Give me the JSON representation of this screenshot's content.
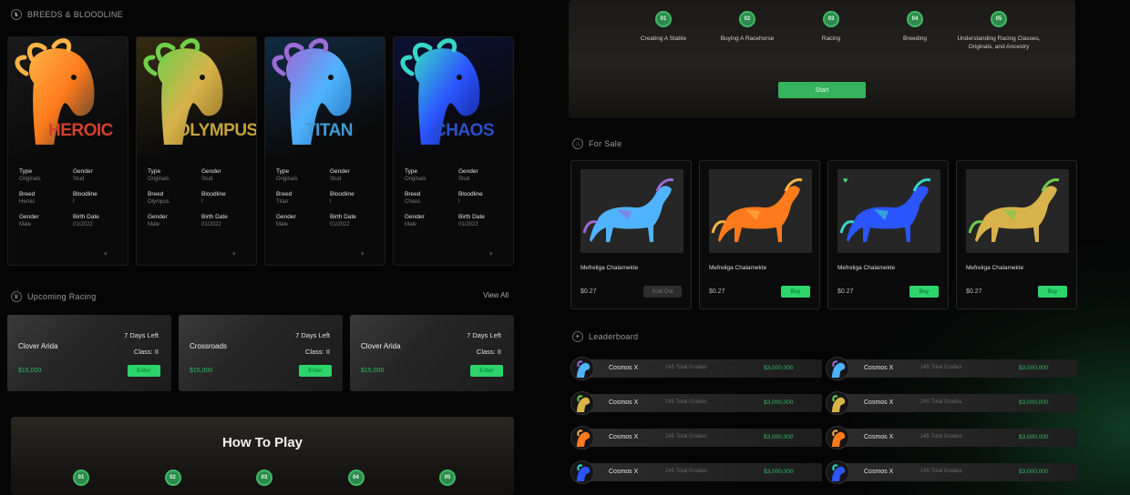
{
  "breeds_section": {
    "title": "BREEDS & BLOODLINE"
  },
  "breeds": [
    {
      "name": "HEROIC",
      "color": "#d2422b",
      "stats": [
        {
          "k": "Type",
          "v": "Originals"
        },
        {
          "k": "Gender",
          "v": "Stud"
        },
        {
          "k": "Breed",
          "v": "Heroic"
        },
        {
          "k": "Bloodline",
          "v": "I"
        },
        {
          "k": "Gender",
          "v": "Male"
        },
        {
          "k": "Birth Date",
          "v": "01/2022"
        }
      ]
    },
    {
      "name": "OLYMPUS",
      "color": "#c5a33c",
      "stats": [
        {
          "k": "Type",
          "v": "Originals"
        },
        {
          "k": "Gender",
          "v": "Stud"
        },
        {
          "k": "Breed",
          "v": "Olympus"
        },
        {
          "k": "Bloodline",
          "v": "I"
        },
        {
          "k": "Gender",
          "v": "Male"
        },
        {
          "k": "Birth Date",
          "v": "01/2022"
        }
      ]
    },
    {
      "name": "TITAN",
      "color": "#3f9bd3",
      "stats": [
        {
          "k": "Type",
          "v": "Originals"
        },
        {
          "k": "Gender",
          "v": "Stud"
        },
        {
          "k": "Breed",
          "v": "Titan"
        },
        {
          "k": "Bloodline",
          "v": "I"
        },
        {
          "k": "Gender",
          "v": "Male"
        },
        {
          "k": "Birth Date",
          "v": "01/2022"
        }
      ]
    },
    {
      "name": "CHAOS",
      "color": "#2c4fc9",
      "stats": [
        {
          "k": "Type",
          "v": "Originals"
        },
        {
          "k": "Gender",
          "v": "Stud"
        },
        {
          "k": "Breed",
          "v": "Chaos"
        },
        {
          "k": "Bloodline",
          "v": "I"
        },
        {
          "k": "Gender",
          "v": "Male"
        },
        {
          "k": "Birth Date",
          "v": "01/2022"
        }
      ]
    }
  ],
  "upcoming": {
    "title": "Upcoming Racing",
    "view_all": "View All"
  },
  "races": [
    {
      "title": "Clover Arida",
      "time_left": "7 Days Left",
      "class": "Class: II",
      "fee": "$15,000",
      "button": "Enter"
    },
    {
      "title": "Crossroads",
      "time_left": "7 Days Left",
      "class": "Class: II",
      "fee": "$15,000",
      "button": "Enter"
    },
    {
      "title": "Clover Arida",
      "time_left": "7 Days Left",
      "class": "Class: II",
      "fee": "$15,000",
      "button": "Enter"
    }
  ],
  "how_to_play": {
    "title": "How To Play",
    "steps": [
      "01",
      "02",
      "03",
      "04",
      "05"
    ]
  },
  "how_steps_top": [
    {
      "num": "01",
      "label": "Creating A Stable"
    },
    {
      "num": "02",
      "label": "Buying A Racehorse"
    },
    {
      "num": "03",
      "label": "Racing"
    },
    {
      "num": "04",
      "label": "Breeding"
    },
    {
      "num": "05",
      "label": "Understanding Racing Classes, Originals, and Ancestry"
    }
  ],
  "start_button": "Start",
  "for_sale": {
    "title": "For Sale"
  },
  "sale_items": [
    {
      "name": "Mefreliga Chalamekte",
      "price": "$0.27",
      "button": "Sold Out",
      "dim": true,
      "fav": false,
      "tone": "titan"
    },
    {
      "name": "Mefreliga Chalamekte",
      "price": "$0.27",
      "button": "Buy",
      "dim": false,
      "fav": false,
      "tone": "heroic"
    },
    {
      "name": "Mefreliga Chalamekte",
      "price": "$0.27",
      "button": "Buy",
      "dim": false,
      "fav": true,
      "tone": "chaos"
    },
    {
      "name": "Mefreliga Chalamekte",
      "price": "$0.27",
      "button": "Buy",
      "dim": false,
      "fav": false,
      "tone": "olympus"
    }
  ],
  "leaderboard": {
    "title": "Leaderboard"
  },
  "leaders": [
    {
      "name": "Cosmos X",
      "sub": "245 Total Grades",
      "amount": "$3,000,000",
      "tone": "titan"
    },
    {
      "name": "Cosmos X",
      "sub": "245 Total Grades",
      "amount": "$3,000,000",
      "tone": "titan"
    },
    {
      "name": "Cosmos X",
      "sub": "245 Total Grades",
      "amount": "$3,000,000",
      "tone": "olympus"
    },
    {
      "name": "Cosmos X",
      "sub": "245 Total Grades",
      "amount": "$3,000,000",
      "tone": "olympus"
    },
    {
      "name": "Cosmos X",
      "sub": "245 Total Grades",
      "amount": "$3,000,000",
      "tone": "heroic"
    },
    {
      "name": "Cosmos X",
      "sub": "245 Total Grades",
      "amount": "$3,000,000",
      "tone": "heroic"
    },
    {
      "name": "Cosmos X",
      "sub": "245 Total Grades",
      "amount": "$3,000,000",
      "tone": "chaos"
    },
    {
      "name": "Cosmos X",
      "sub": "245 Total Grades",
      "amount": "$3,000,000",
      "tone": "chaos"
    }
  ],
  "colors": {
    "accent": "#2dd46b",
    "background": "#050505",
    "card": "#0b0b0b"
  }
}
